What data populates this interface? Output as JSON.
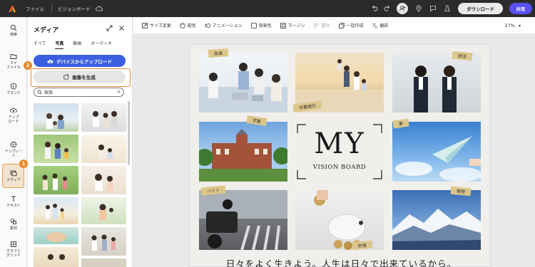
{
  "topbar": {
    "menu_file": "ファイル",
    "board_title": "ビジョンボード",
    "download_label": "ダウンロード",
    "share_label": "共有",
    "accent": "#5a4ff3"
  },
  "rail": {
    "items": [
      {
        "label": "検索",
        "icon": "search-icon"
      },
      {
        "label": "マイ\nファイル",
        "icon": "folder-icon"
      },
      {
        "label": "ブランド",
        "icon": "brand-icon"
      },
      {
        "label": "アップ\nロード",
        "icon": "upload-icon"
      },
      {
        "label": "テンプレー\nト",
        "icon": "template-icon"
      },
      {
        "label": "メディア",
        "icon": "media-icon"
      },
      {
        "label": "テキスト",
        "icon": "text-icon"
      },
      {
        "label": "素材",
        "icon": "elements-icon"
      },
      {
        "label": "グラフと\nグリッド",
        "icon": "grid-icon"
      }
    ],
    "active": "メディア",
    "badge_media": "1",
    "badge_generate": "2"
  },
  "panel": {
    "title": "メディア",
    "tabs": [
      "すべて",
      "写真",
      "動画",
      "オーディオ"
    ],
    "active_tab": "写真",
    "upload_label": "デバイスからアップロード",
    "generate_label": "画像を生成",
    "search_value": "家族",
    "clear_icon": "close-icon"
  },
  "toolbar": {
    "items": [
      {
        "label": "サイズ変更",
        "icon": "resize-icon",
        "dim": false
      },
      {
        "label": "配色",
        "icon": "palette-icon",
        "dim": false
      },
      {
        "label": "アニメーション",
        "icon": "animation-icon",
        "dim": false
      },
      {
        "label": "背景色",
        "icon": "background-icon",
        "dim": false
      },
      {
        "label": "マージン",
        "icon": "margin-icon",
        "dim": false
      },
      {
        "label": "整列",
        "icon": "align-icon",
        "dim": true
      },
      {
        "label": "一括作成",
        "icon": "bulk-create-icon",
        "dim": false
      },
      {
        "label": "翻訳",
        "icon": "translate-icon",
        "dim": false
      }
    ],
    "zoom": "27%"
  },
  "board": {
    "title_main": "MY",
    "title_sub": "VISION BOARD",
    "tagline": "日々をよく生きよう。人生は日々で出来ているから。",
    "tags": {
      "friends": "友達",
      "graduation": "卒業旅行",
      "job": "就活",
      "study": "学業",
      "dream": "夢",
      "part_time": "バイト",
      "savings": "貯金",
      "ideal": "理想"
    }
  }
}
